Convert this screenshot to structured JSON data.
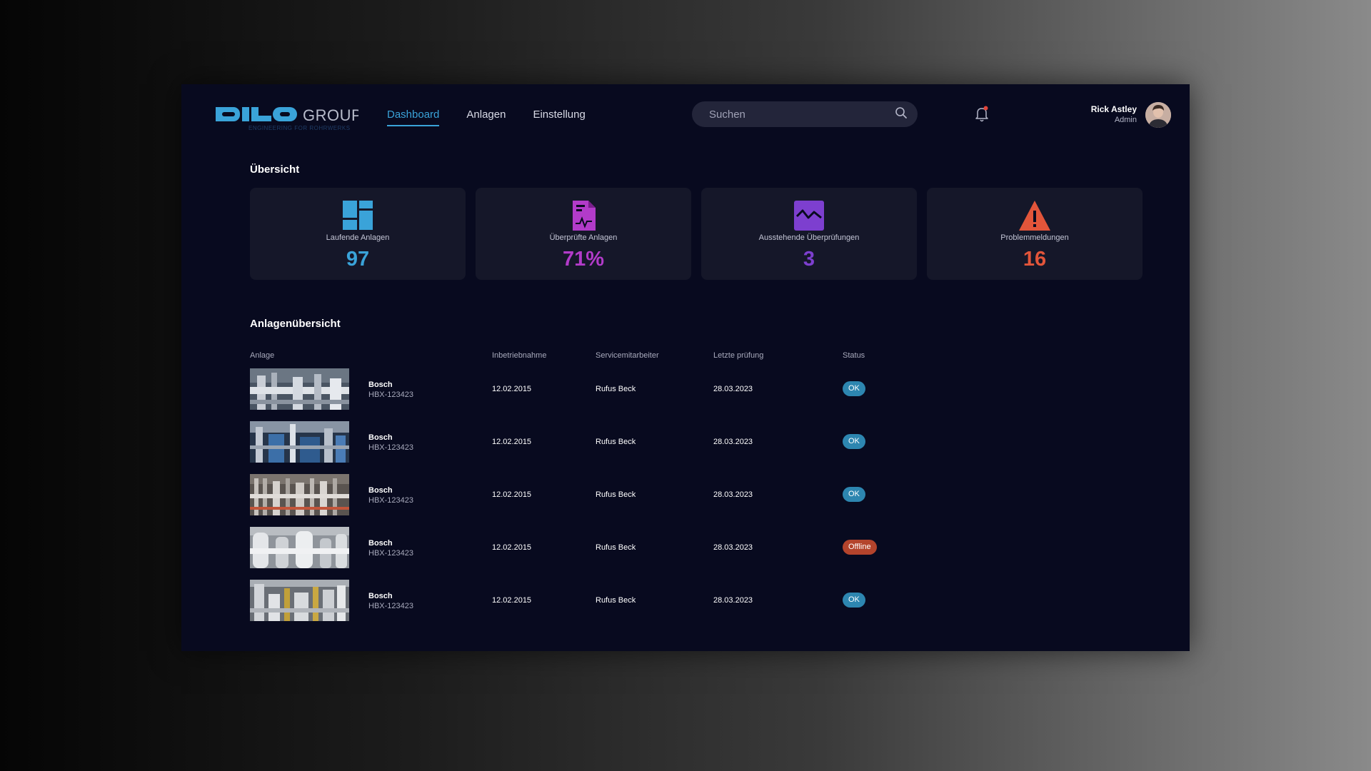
{
  "brand": {
    "logo_mark": "DILO",
    "logo_text": "GROUP",
    "tagline": "ENGINEERING FOR ROHRWERKS"
  },
  "nav": [
    {
      "label": "Dashboard",
      "active": true
    },
    {
      "label": "Anlagen",
      "active": false
    },
    {
      "label": "Einstellung",
      "active": false
    }
  ],
  "search": {
    "placeholder": "Suchen",
    "icon": "search-icon"
  },
  "notifications": {
    "icon": "bell-icon",
    "has_unread": true
  },
  "user": {
    "name": "Rick Astley",
    "role": "Admin"
  },
  "overview": {
    "title": "Übersicht",
    "cards": [
      {
        "label": "Laufende Anlagen",
        "value": "97",
        "color": "#3aa3d9",
        "icon": "dashboard-tiles-icon"
      },
      {
        "label": "Überprüfte Anlagen",
        "value": "71%",
        "color": "#b23bc9",
        "icon": "report-document-icon"
      },
      {
        "label": "Ausstehende Überprüfungen",
        "value": "3",
        "color": "#7d3fcf",
        "icon": "pending-chart-icon"
      },
      {
        "label": "Problemmeldungen",
        "value": "16",
        "color": "#e2553a",
        "icon": "warning-triangle-icon"
      }
    ]
  },
  "plants": {
    "title": "Anlagenübersicht",
    "columns": [
      "Anlage",
      "Inbetriebnahme",
      "Servicemitarbeiter",
      "Letzte prüfung",
      "Status"
    ],
    "rows": [
      {
        "name": "Bosch",
        "id": "HBX-123423",
        "commissioned": "12.02.2015",
        "technician": "Rufus Beck",
        "last_check": "28.03.2023",
        "status": "OK",
        "status_color": "#2d86b0"
      },
      {
        "name": "Bosch",
        "id": "HBX-123423",
        "commissioned": "12.02.2015",
        "technician": "Rufus Beck",
        "last_check": "28.03.2023",
        "status": "OK",
        "status_color": "#2d86b0"
      },
      {
        "name": "Bosch",
        "id": "HBX-123423",
        "commissioned": "12.02.2015",
        "technician": "Rufus Beck",
        "last_check": "28.03.2023",
        "status": "OK",
        "status_color": "#2d86b0"
      },
      {
        "name": "Bosch",
        "id": "HBX-123423",
        "commissioned": "12.02.2015",
        "technician": "Rufus Beck",
        "last_check": "28.03.2023",
        "status": "Offline",
        "status_color": "#b4442c"
      },
      {
        "name": "Bosch",
        "id": "HBX-123423",
        "commissioned": "12.02.2015",
        "technician": "Rufus Beck",
        "last_check": "28.03.2023",
        "status": "OK",
        "status_color": "#2d86b0"
      }
    ]
  }
}
